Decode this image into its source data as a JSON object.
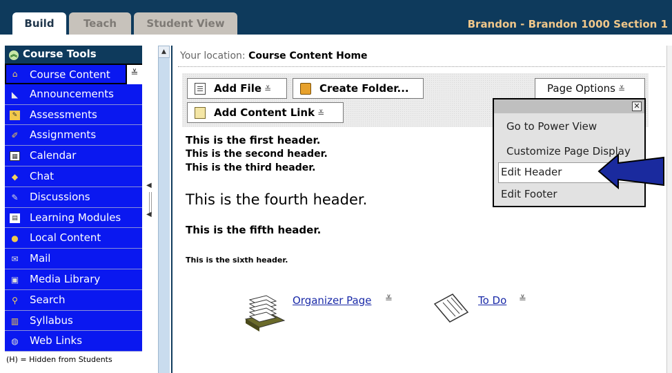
{
  "tabs": {
    "build": "Build",
    "teach": "Teach",
    "student_view": "Student View"
  },
  "course_title": "Brandon - Brandon 1000 Section 1",
  "sidebar": {
    "header": "Course Tools",
    "items": [
      {
        "label": "Course Content",
        "icon": "home-icon",
        "active": true
      },
      {
        "label": "Announcements",
        "icon": "megaphone-icon"
      },
      {
        "label": "Assessments",
        "icon": "assessment-icon"
      },
      {
        "label": "Assignments",
        "icon": "assignment-icon"
      },
      {
        "label": "Calendar",
        "icon": "calendar-icon"
      },
      {
        "label": "Chat",
        "icon": "chat-icon"
      },
      {
        "label": "Discussions",
        "icon": "discussion-icon"
      },
      {
        "label": "Learning Modules",
        "icon": "module-icon"
      },
      {
        "label": "Local Content",
        "icon": "disc-icon"
      },
      {
        "label": "Mail",
        "icon": "mail-icon"
      },
      {
        "label": "Media Library",
        "icon": "media-icon"
      },
      {
        "label": "Search",
        "icon": "search-icon"
      },
      {
        "label": "Syllabus",
        "icon": "syllabus-icon"
      },
      {
        "label": "Web Links",
        "icon": "globe-icon"
      }
    ],
    "hidden_note": "(H) = Hidden from Students"
  },
  "location": {
    "label": "Your location:",
    "value": "Course Content Home"
  },
  "toolbar": {
    "add_file": "Add File",
    "create_folder": "Create Folder...",
    "add_content_link": "Add Content Link",
    "page_options": "Page Options"
  },
  "menu": {
    "power_view": "Go to Power View",
    "customize": "Customize Page Display",
    "edit_header": "Edit Header",
    "edit_footer": "Edit Footer"
  },
  "headers": {
    "h1": "This is the first header.",
    "h2": "This is the second header.",
    "h3": "This is the third header.",
    "h4": "This is the fourth header.",
    "h5": "This is the fifth header.",
    "h6": "This is the sixth header."
  },
  "items": {
    "organizer": "Organizer Page",
    "todo": "To Do"
  },
  "colors": {
    "topbar": "#0e3a5c",
    "sidebar_item": "#0a18f0",
    "course_title": "#f0c78a",
    "link": "#1a2aa8",
    "arrow": "#1a2a9e"
  }
}
